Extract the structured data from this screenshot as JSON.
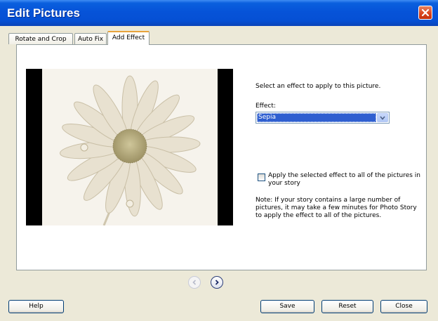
{
  "window": {
    "title": "Edit Pictures"
  },
  "tabs": [
    {
      "label": "Rotate and Crop",
      "active": false
    },
    {
      "label": "Auto Fix",
      "active": false
    },
    {
      "label": "Add Effect",
      "active": true
    }
  ],
  "effect_panel": {
    "instruction": "Select an effect to apply to this picture.",
    "effect_label": "Effect:",
    "effect_value": "Sepia",
    "apply_all_label": "Apply the selected effect to all of the pictures in your story",
    "apply_all_checked": false,
    "note": "Note: If your story contains a large number of pictures, it may take a few minutes for Photo Story to apply the effect to all of the pictures."
  },
  "buttons": {
    "help": "Help",
    "save": "Save",
    "reset": "Reset",
    "close": "Close"
  },
  "icons": {
    "close": "close-icon",
    "prev": "chevron-left-icon",
    "next": "chevron-right-icon",
    "dropdown": "chevron-down-icon"
  },
  "colors": {
    "titlebar": "#0653d8",
    "selection": "#2f5fd0",
    "close_button": "#d8411c",
    "sepia_tone": "#efe8d6"
  }
}
